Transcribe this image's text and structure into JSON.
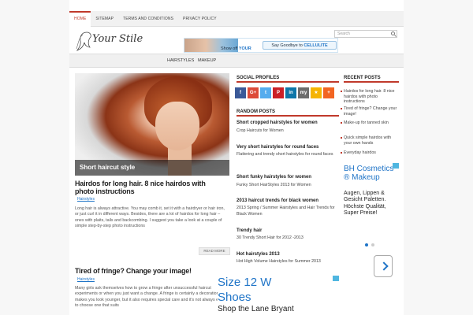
{
  "topnav": {
    "items": [
      "HOME",
      "SITEMAP",
      "TERMS AND CONDITIONS",
      "PRIVACY POLICY"
    ]
  },
  "header": {
    "logo_text": "Your Stile",
    "banner": {
      "showoff_prefix": "Show off",
      "showoff_bold": "YOUR",
      "cta_prefix": "Say Goodbye to",
      "cta_bold": "CELLULITE"
    },
    "search_placeholder": "Search"
  },
  "mainnav": {
    "items": [
      "HAIRSTYLES",
      "MAKEUP"
    ]
  },
  "hero": {
    "caption": "Short haircut style"
  },
  "posts": [
    {
      "title": "Hairdos for long hair. 8 nice hairdos with photo instructions",
      "category": "Hairstyles",
      "excerpt": "Long hair is always attractive. You may comb it, set it with a hairdryer or hair iron, or just curl it in different ways. Besides, there are a lot of hairdos for long hair – ones with plaits, tails and backcombing. I suggest you take a look at a couple of simple step-by-step photo instructions",
      "readmore": "READ MORE"
    },
    {
      "title": "Tired of fringe? Change your image!",
      "category": "Hairstyles",
      "excerpt": "Many girls ask themselves how to grow a fringe after unsuccessful haircut experiments or when you just want a change. A fringe is certainly a decoration that makes you look younger, but it also requires special care and it's not always easy to choose one that suits"
    }
  ],
  "social": {
    "heading": "SOCIAL PROFILES",
    "buttons": [
      {
        "label": "f",
        "color": "#3b5998",
        "icon": "facebook-icon"
      },
      {
        "label": "G+",
        "color": "#dd4b39",
        "icon": "google-plus-icon"
      },
      {
        "label": "t",
        "color": "#55acee",
        "icon": "twitter-icon"
      },
      {
        "label": "P",
        "color": "#cb2027",
        "icon": "pinterest-icon"
      },
      {
        "label": "in",
        "color": "#0e76a8",
        "icon": "linkedin-icon"
      },
      {
        "label": "my",
        "color": "#6c6c6c",
        "icon": "myspace-icon"
      },
      {
        "label": "★",
        "color": "#f5b400",
        "icon": "star-icon"
      },
      {
        "label": "+",
        "color": "#f26522",
        "icon": "more-icon"
      }
    ]
  },
  "random_posts": {
    "heading": "RANDOM POSTS",
    "items": [
      {
        "title": "Short cropped hairstyles for women",
        "sub": "Crop Haircuts for Women"
      },
      {
        "title": "Very short hairstyles for round faces",
        "sub": "Flattering and trendy short hairstyles for round faces"
      },
      {
        "title": "Short funky hairstyles for women",
        "sub": "Funky Short HairStyles 2013 for Women"
      },
      {
        "title": "2013 haircut trends for black women",
        "sub": "2013 Spring / Summer Hairstyles and Hair Trends for Black Women"
      },
      {
        "title": "Trendy hair",
        "sub": "30 Trendy Short Hair for 2012 -2013"
      },
      {
        "title": "Hot hairstyles 2013",
        "sub": "Hot High Volume Hairstyles for Summer 2013"
      }
    ]
  },
  "recent_posts": {
    "heading": "RECENT POSTS",
    "items": [
      "Hairdos for long hair. 8 nice hairdos with photo instructions",
      "Tired of fringe? Change your image!",
      "Make-up for tanned skin",
      "Quick simple hairdos with your own hands",
      "Everyday hairdos"
    ]
  },
  "ad_right": {
    "title": "BH Cosmetics ® Makeup",
    "body": "Augen, Lippen & Gesicht Paletten. Höchste Qualität, Super Preise!"
  },
  "ad_bottom": {
    "line1": "Size 12 W",
    "line2": "Shoes",
    "line3": "Shop the Lane Bryant"
  }
}
